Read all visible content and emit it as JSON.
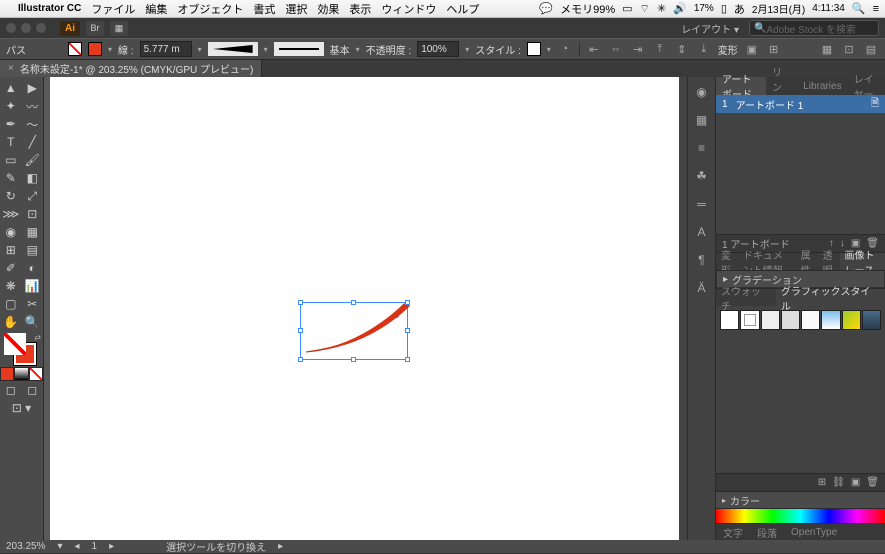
{
  "menubar": {
    "app": "Illustrator CC",
    "items": [
      "ファイル",
      "編集",
      "オブジェクト",
      "書式",
      "選択",
      "効果",
      "表示",
      "ウィンドウ",
      "ヘルプ"
    ],
    "right": {
      "battery": "17%",
      "date": "2月13日(月)",
      "time": "4:11:34",
      "mem": "メモリ99%"
    }
  },
  "appbar": {
    "layout": "レイアウト ▾",
    "search_placeholder": "Adobe Stock を検索"
  },
  "optbar": {
    "label_path": "パス",
    "label_line": "線 :",
    "stroke_val": "5.777 m",
    "uniform": "基本",
    "opacity_label": "不透明度 :",
    "opacity_val": "100%",
    "style_label": "スタイル :",
    "transform": "変形"
  },
  "tab": {
    "title": "名称未設定-1* @ 203.25% (CMYK/GPU プレビュー)"
  },
  "panels": {
    "artboard_tabs": [
      "アートボード",
      "リンク",
      "Libraries",
      "レイヤー"
    ],
    "artboard_row": {
      "num": "1",
      "name": "アートボード 1"
    },
    "artboard_count": "1 アートボード",
    "props_tabs": [
      "変形",
      "ドキュメント情報",
      "属性",
      "透明",
      "画像トレース"
    ],
    "gradation": "グラデーション",
    "style_tabs": [
      "スウォッチ",
      "グラフィックスタイル"
    ],
    "color": "カラー",
    "bottom": [
      "文字",
      "段落",
      "OpenType"
    ]
  },
  "statusbar": {
    "zoom": "203.25%",
    "page": "1",
    "tool": "選択ツールを切り換え"
  }
}
